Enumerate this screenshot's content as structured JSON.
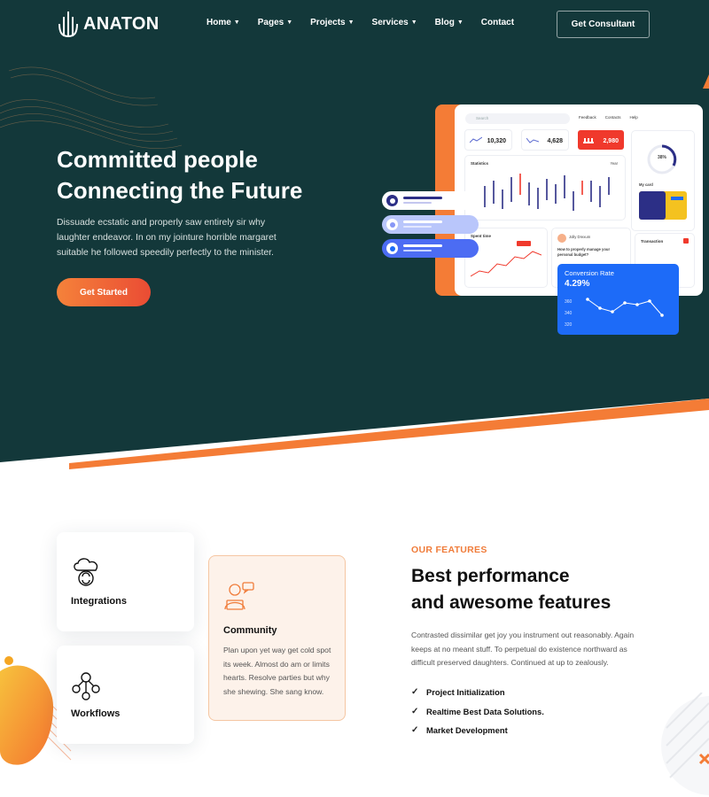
{
  "brand": {
    "name": "ANATON",
    "accent": "#f47c36",
    "dark_bg": "#13383a",
    "blue": "#1d6bf8"
  },
  "nav": {
    "items": [
      {
        "label": "Home",
        "dropdown": true
      },
      {
        "label": "Pages",
        "dropdown": true
      },
      {
        "label": "Projects",
        "dropdown": true
      },
      {
        "label": "Services",
        "dropdown": true
      },
      {
        "label": "Blog",
        "dropdown": true
      },
      {
        "label": "Contact",
        "dropdown": false
      }
    ],
    "cta_label": "Get Consultant"
  },
  "hero": {
    "title_line1": "Committed people",
    "title_line2": "Connecting the Future",
    "description": "Dissuade ecstatic and properly saw entirely sir why laughter endeavor. In on my jointure horrible margaret suitable he followed speedily perfectly to the minister.",
    "button_label": "Get Started"
  },
  "dashboard": {
    "search_placeholder": "Search",
    "top_links": [
      "Feedback",
      "Contacts",
      "Help"
    ],
    "stats": [
      "10,320",
      "4,628",
      "2,980"
    ],
    "statistics_title": "Statistics",
    "year_select": "Year",
    "gauge_value": "38%",
    "mycard_title": "My card",
    "spent_title": "Spent time",
    "transaction_title": "Transaction",
    "author": "Jolly Drexum",
    "question": "How to properly manage your personal budget?",
    "conversion": {
      "label": "Conversion Rate",
      "value": "4.29%",
      "ticks": [
        "360",
        "340",
        "320"
      ]
    }
  },
  "features": {
    "eyebrow": "OUR FEATURES",
    "title_line1": "Best performance",
    "title_line2": "and awesome features",
    "description": "Contrasted dissimilar get joy you instrument out reasonably. Again keeps at no meant stuff. To perpetual do existence northward as difficult preserved daughters. Continued at up to zealously.",
    "checklist": [
      "Project Initialization",
      "Realtime Best Data Solutions.",
      "Market Development"
    ],
    "cards": {
      "integrations": "Integrations",
      "workflows": "Workflows",
      "community_title": "Community",
      "community_text": "Plan upon yet way get cold spot its week. Almost do am or limits hearts. Resolve parties but why she shewing. She sang know."
    }
  }
}
